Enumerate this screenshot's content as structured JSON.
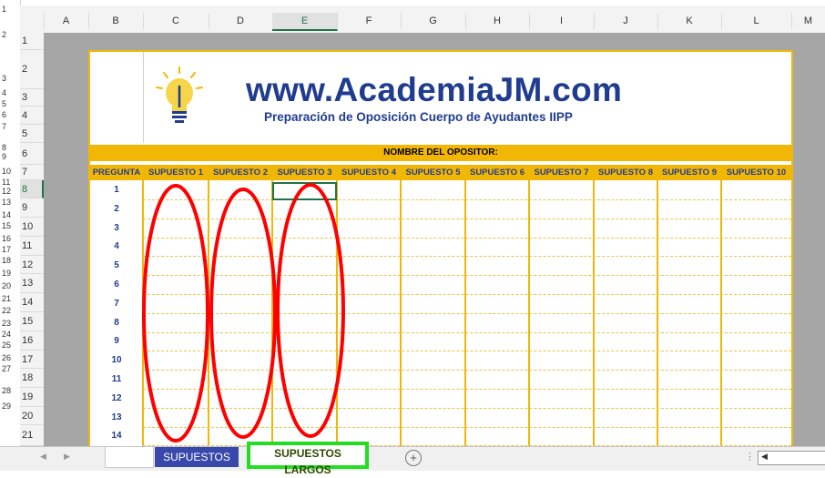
{
  "outline_numbers": [
    "1",
    "2",
    "3",
    "4",
    "5",
    "6",
    "7",
    "8",
    "9",
    "10",
    "11",
    "12",
    "13",
    "14",
    "15",
    "16",
    "17",
    "18",
    "19",
    "20",
    "21",
    "22",
    "23",
    "24",
    "25",
    "26",
    "27",
    "28",
    "29"
  ],
  "columns": [
    "A",
    "B",
    "C",
    "D",
    "E",
    "F",
    "G",
    "H",
    "I",
    "J",
    "K",
    "L",
    "M"
  ],
  "selected_column": "E",
  "rows": [
    "1",
    "2",
    "3",
    "4",
    "5",
    "6",
    "7",
    "8",
    "9",
    "10",
    "11",
    "12",
    "13",
    "14",
    "15",
    "16",
    "17",
    "18",
    "19",
    "20",
    "21"
  ],
  "selected_row": "8",
  "banner": {
    "title": "www.AcademiaJM.com",
    "subtitle": "Preparación de Oposición Cuerpo de Ayudantes IIPP"
  },
  "nombre_label": "NOMBRE DEL OPOSITOR:",
  "header_cells": [
    "PREGUNTA",
    "SUPUESTO 1",
    "SUPUESTO 2",
    "SUPUESTO 3",
    "SUPUESTO 4",
    "SUPUESTO 5",
    "SUPUESTO 6",
    "SUPUESTO 7",
    "SUPUESTO 8",
    "SUPUESTO 9",
    "SUPUESTO 10"
  ],
  "preguntas": [
    "1",
    "2",
    "3",
    "4",
    "5",
    "6",
    "7",
    "8",
    "9",
    "10",
    "11",
    "12",
    "13",
    "14"
  ],
  "tabs": {
    "sheet1": "SUPUESTOS",
    "sheet2": "SUPUESTOS LARGOS"
  },
  "colors": {
    "accent_yellow": "#f2b705",
    "title_blue": "#1f3c8f",
    "annotation_red": "#ff0000",
    "annotation_green": "#22dd22",
    "excel_green": "#217346"
  },
  "icons": [
    "lightbulb-icon",
    "add-sheet-icon",
    "scroll-left-icon",
    "scroll-right-icon"
  ]
}
